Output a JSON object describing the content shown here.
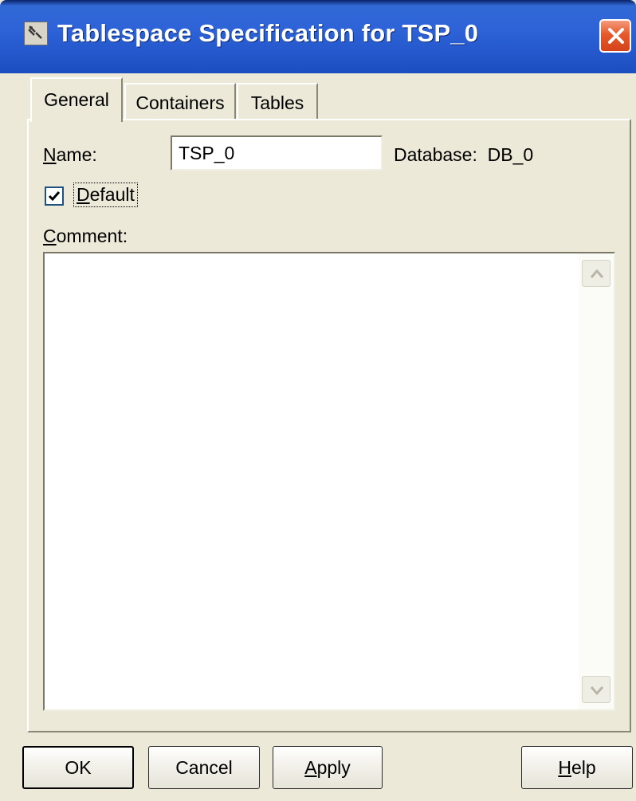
{
  "window": {
    "title": "Tablespace Specification for TSP_0"
  },
  "tabs": [
    {
      "label": "General",
      "selected": true
    },
    {
      "label": "Containers",
      "selected": false
    },
    {
      "label": "Tables",
      "selected": false
    }
  ],
  "general": {
    "name_label_mnemonic": "N",
    "name_label_rest": "ame:",
    "name_value": "TSP_0",
    "database_label": "Database:",
    "database_value": "DB_0",
    "default_checked": true,
    "default_label_mnemonic": "D",
    "default_label_rest": "efault",
    "comment_label_mnemonic": "C",
    "comment_label_rest": "omment:",
    "comment_value": ""
  },
  "buttons": {
    "ok": "OK",
    "cancel": "Cancel",
    "apply_mnemonic": "A",
    "apply_rest": "pply",
    "help_mnemonic": "H",
    "help_rest": "elp"
  },
  "icons": {
    "title": "tablespace-icon",
    "close": "close-icon",
    "check": "checkmark-icon",
    "scroll_up": "scroll-up-arrow-icon",
    "scroll_down": "scroll-down-arrow-icon"
  },
  "colors": {
    "titlebar": "#2458cc",
    "dialog_face": "#ece9d8",
    "close_button": "#e55a2c"
  }
}
